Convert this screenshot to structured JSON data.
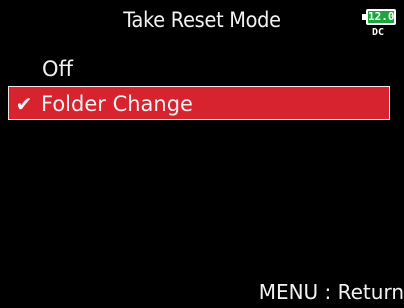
{
  "header": {
    "title": "Take Reset Mode",
    "battery_level": "12.0",
    "power_source": "DC"
  },
  "menu": {
    "options": [
      {
        "label": "Off",
        "selected": false
      },
      {
        "label": "Folder Change",
        "selected": true
      }
    ],
    "selected_check": "✔"
  },
  "footer": {
    "hint": "MENU : Return"
  },
  "colors": {
    "background": "#000000",
    "selection": "#d7232e",
    "battery_fill": "#19a63a"
  }
}
